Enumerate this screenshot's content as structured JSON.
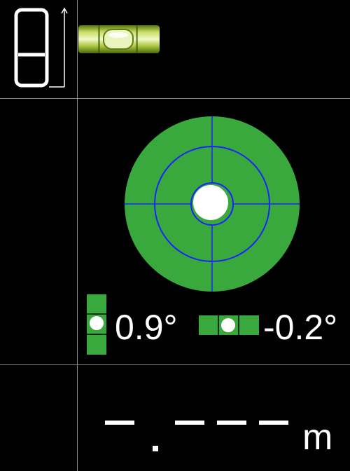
{
  "level": {
    "y_angle_text": "0.9°",
    "x_angle_text": "-0.2°"
  },
  "distance": {
    "unit": "m"
  },
  "icons": {
    "mode": "phone-orientation-icon",
    "tube": "tube-level-icon",
    "bullseye": "bullseye-level-icon",
    "vertical_bubble": "vertical-bubble-icon",
    "horizontal_bubble": "horizontal-bubble-icon"
  },
  "colors": {
    "background": "#000000",
    "level_green": "#3aa93d",
    "ring_blue": "#1b22ff",
    "bubble": "#ffffff",
    "grid": "#8a8a8a"
  }
}
